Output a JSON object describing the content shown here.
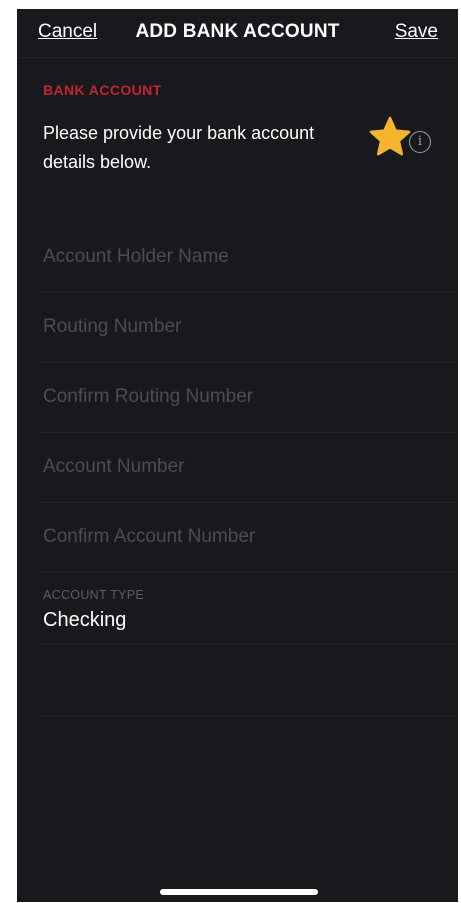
{
  "header": {
    "cancel_label": "Cancel",
    "title": "ADD BANK ACCOUNT",
    "save_label": "Save"
  },
  "section": {
    "label": "BANK ACCOUNT",
    "intro": "Please provide your bank account details below.",
    "info_icon": "info-icon",
    "star_icon": "star-icon"
  },
  "fields": [
    {
      "placeholder": "Account Holder Name",
      "value": ""
    },
    {
      "placeholder": "Routing Number",
      "value": ""
    },
    {
      "placeholder": "Confirm Routing Number",
      "value": ""
    },
    {
      "placeholder": "Account Number",
      "value": ""
    },
    {
      "placeholder": "Confirm Account Number",
      "value": ""
    }
  ],
  "account_type": {
    "label": "ACCOUNT TYPE",
    "value": "Checking"
  },
  "colors": {
    "background": "#17191d",
    "accent_red": "#c62233",
    "star": "#f5b52b"
  }
}
